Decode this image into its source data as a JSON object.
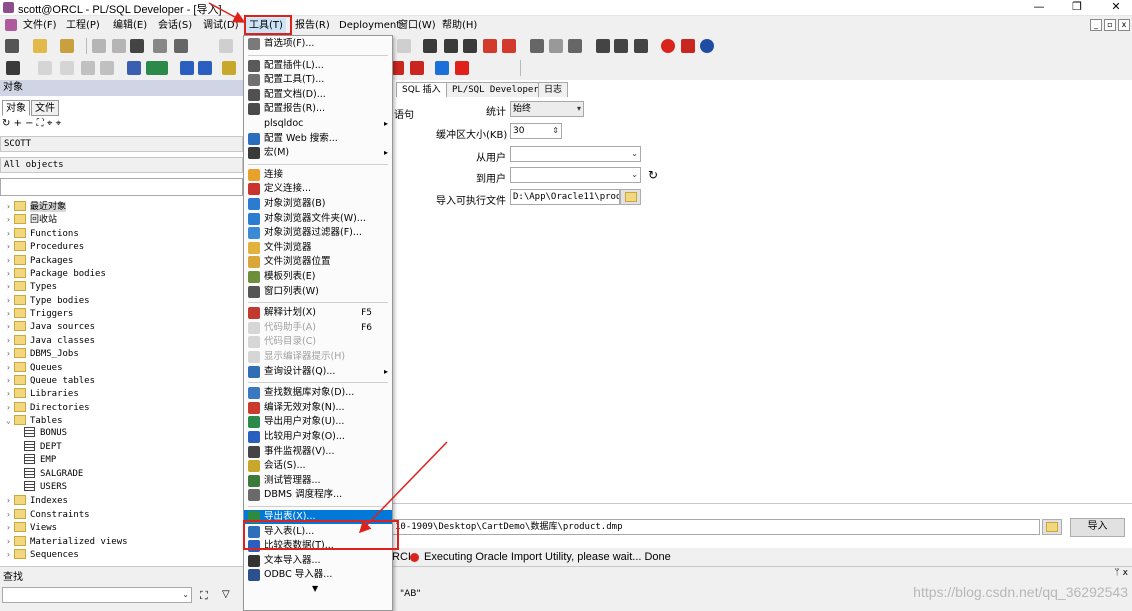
{
  "window": {
    "title": "scott@ORCL - PL/SQL Developer - [导入]",
    "controls": {
      "minimize": "—",
      "restore": "❐",
      "close": "✕"
    }
  },
  "menubar": {
    "items": [
      "文件(F)",
      "工程(P)",
      "编辑(E)",
      "会话(S)",
      "调试(D)",
      "工具(T)",
      "报告(R)",
      "Deployment",
      "窗口(W)",
      "帮助(H)"
    ],
    "mdi_controls": {
      "minimize": "_",
      "restore": "▫",
      "close": "x"
    }
  },
  "object_browser": {
    "panel_title": "对象",
    "tabs": [
      "对象",
      "文件"
    ],
    "toolbar_glyphs": "↻ + − ⛶ ⌖ ⌖",
    "user": "SCOTT",
    "filter": "All objects",
    "search_value": "",
    "tree": [
      {
        "label": "最近对象",
        "expanded": false,
        "highlight": true
      },
      {
        "label": "回收站",
        "expanded": false
      },
      {
        "label": "Functions",
        "expanded": false
      },
      {
        "label": "Procedures",
        "expanded": false
      },
      {
        "label": "Packages",
        "expanded": false
      },
      {
        "label": "Package bodies",
        "expanded": false
      },
      {
        "label": "Types",
        "expanded": false
      },
      {
        "label": "Type bodies",
        "expanded": false
      },
      {
        "label": "Triggers",
        "expanded": false
      },
      {
        "label": "Java sources",
        "expanded": false
      },
      {
        "label": "Java classes",
        "expanded": false
      },
      {
        "label": "DBMS_Jobs",
        "expanded": false
      },
      {
        "label": "Queues",
        "expanded": false
      },
      {
        "label": "Queue tables",
        "expanded": false
      },
      {
        "label": "Libraries",
        "expanded": false
      },
      {
        "label": "Directories",
        "expanded": false
      },
      {
        "label": "Tables",
        "expanded": true
      },
      {
        "label": "BONUS",
        "child": true
      },
      {
        "label": "DEPT",
        "child": true
      },
      {
        "label": "EMP",
        "child": true
      },
      {
        "label": "SALGRADE",
        "child": true
      },
      {
        "label": "USERS",
        "child": true
      },
      {
        "label": "Indexes",
        "expanded": false
      },
      {
        "label": "Constraints",
        "expanded": false
      },
      {
        "label": "Views",
        "expanded": false
      },
      {
        "label": "Materialized views",
        "expanded": false
      },
      {
        "label": "Sequences",
        "expanded": false
      }
    ]
  },
  "import_dialog": {
    "tabs": [
      "SQL 插入",
      "PL/SQL Developer",
      "日志"
    ],
    "statement_label": "语句",
    "stats_label": "统计",
    "stats_value": "始终",
    "buffer_label": "缓冲区大小(KB)",
    "buffer_value": "30",
    "from_user_label": "从用户",
    "from_user_value": "",
    "to_user_label": "到用户",
    "to_user_value": "",
    "exec_label": "导入可执行文件",
    "exec_value": "D:\\App\\Oracle11\\produ",
    "file_path": "10-1909\\Desktop\\CartDemo\\数据库\\product.dmp",
    "import_button": "导入",
    "status": "Executing Oracle Import Utility, please wait... Done",
    "status_prefix": "RCI"
  },
  "tools_menu": {
    "items": [
      {
        "label": "首选项(F)...",
        "icon_color": "#7a7a7a"
      },
      {
        "sep": true
      },
      {
        "label": "配置插件(L)...",
        "icon_color": "#5a5a5a"
      },
      {
        "label": "配置工具(T)...",
        "icon_color": "#707070"
      },
      {
        "label": "配置文档(D)...",
        "icon_color": "#505050"
      },
      {
        "label": "配置报告(R)...",
        "icon_color": "#4a4a4a"
      },
      {
        "label": "plsqldoc",
        "submenu": true
      },
      {
        "label": "配置 Web 搜索...",
        "icon_color": "#2a6fbe"
      },
      {
        "label": "宏(M)",
        "submenu": true,
        "icon_color": "#3a3a3a"
      },
      {
        "sep": true
      },
      {
        "label": "连接",
        "icon_color": "#e8a22b"
      },
      {
        "label": "定义连接...",
        "icon_color": "#c9342e"
      },
      {
        "label": "对象浏览器(B)",
        "icon_color": "#2b7bd0"
      },
      {
        "label": "对象浏览器文件夹(W)...",
        "icon_color": "#2b7bd0"
      },
      {
        "label": "对象浏览器过滤器(F)...",
        "icon_color": "#3a8ad6"
      },
      {
        "label": "文件浏览器",
        "icon_color": "#e2b23c"
      },
      {
        "label": "文件浏览器位置",
        "icon_color": "#d9a63a"
      },
      {
        "label": "模板列表(E)",
        "icon_color": "#6d8f3b"
      },
      {
        "label": "窗口列表(W)",
        "icon_color": "#555555"
      },
      {
        "sep": true
      },
      {
        "label": "解释计划(X)",
        "shortcut": "F5",
        "icon_color": "#c23a2f"
      },
      {
        "label": "代码助手(A)",
        "shortcut": "F6",
        "disabled": true
      },
      {
        "label": "代码目录(C)",
        "disabled": true
      },
      {
        "label": "显示编译器提示(H)",
        "disabled": true
      },
      {
        "label": "查询设计器(Q)...",
        "submenu": true,
        "icon_color": "#2f6db5"
      },
      {
        "sep": true
      },
      {
        "label": "查找数据库对象(D)...",
        "icon_color": "#3b78c2"
      },
      {
        "label": "编译无效对象(N)...",
        "icon_color": "#c93b2d"
      },
      {
        "label": "导出用户对象(U)...",
        "icon_color": "#2b8a4a"
      },
      {
        "label": "比较用户对象(O)...",
        "icon_color": "#2b5fbf"
      },
      {
        "label": "事件监视器(V)...",
        "icon_color": "#444444"
      },
      {
        "label": "会话(S)...",
        "icon_color": "#c8a82a"
      },
      {
        "label": "测试管理器...",
        "icon_color": "#3c7a3c"
      },
      {
        "label": "DBMS 调度程序...",
        "icon_color": "#6a6a6a"
      },
      {
        "sep": true
      },
      {
        "label": "导出表(X)...",
        "selected": true,
        "icon_color": "#2d8a3e"
      },
      {
        "label": "导入表(L)...",
        "icon_color": "#2d6fb8"
      },
      {
        "label": "比较表数据(T)...",
        "icon_color": "#2b5fbf"
      },
      {
        "label": "文本导入器...",
        "icon_color": "#333333"
      },
      {
        "label": "ODBC 导入器...",
        "icon_color": "#2b4f8f"
      },
      {
        "more": "▼"
      }
    ]
  },
  "find_panel": {
    "title": "查找",
    "pin": "ᛘ x",
    "value": "",
    "options": "\"AB\""
  },
  "watermark": "https://blog.csdn.net/qq_36292543",
  "colors": {
    "highlight_red": "#e0201b",
    "selection_blue": "#0078d7",
    "panel_head": "#cfd5e4"
  }
}
